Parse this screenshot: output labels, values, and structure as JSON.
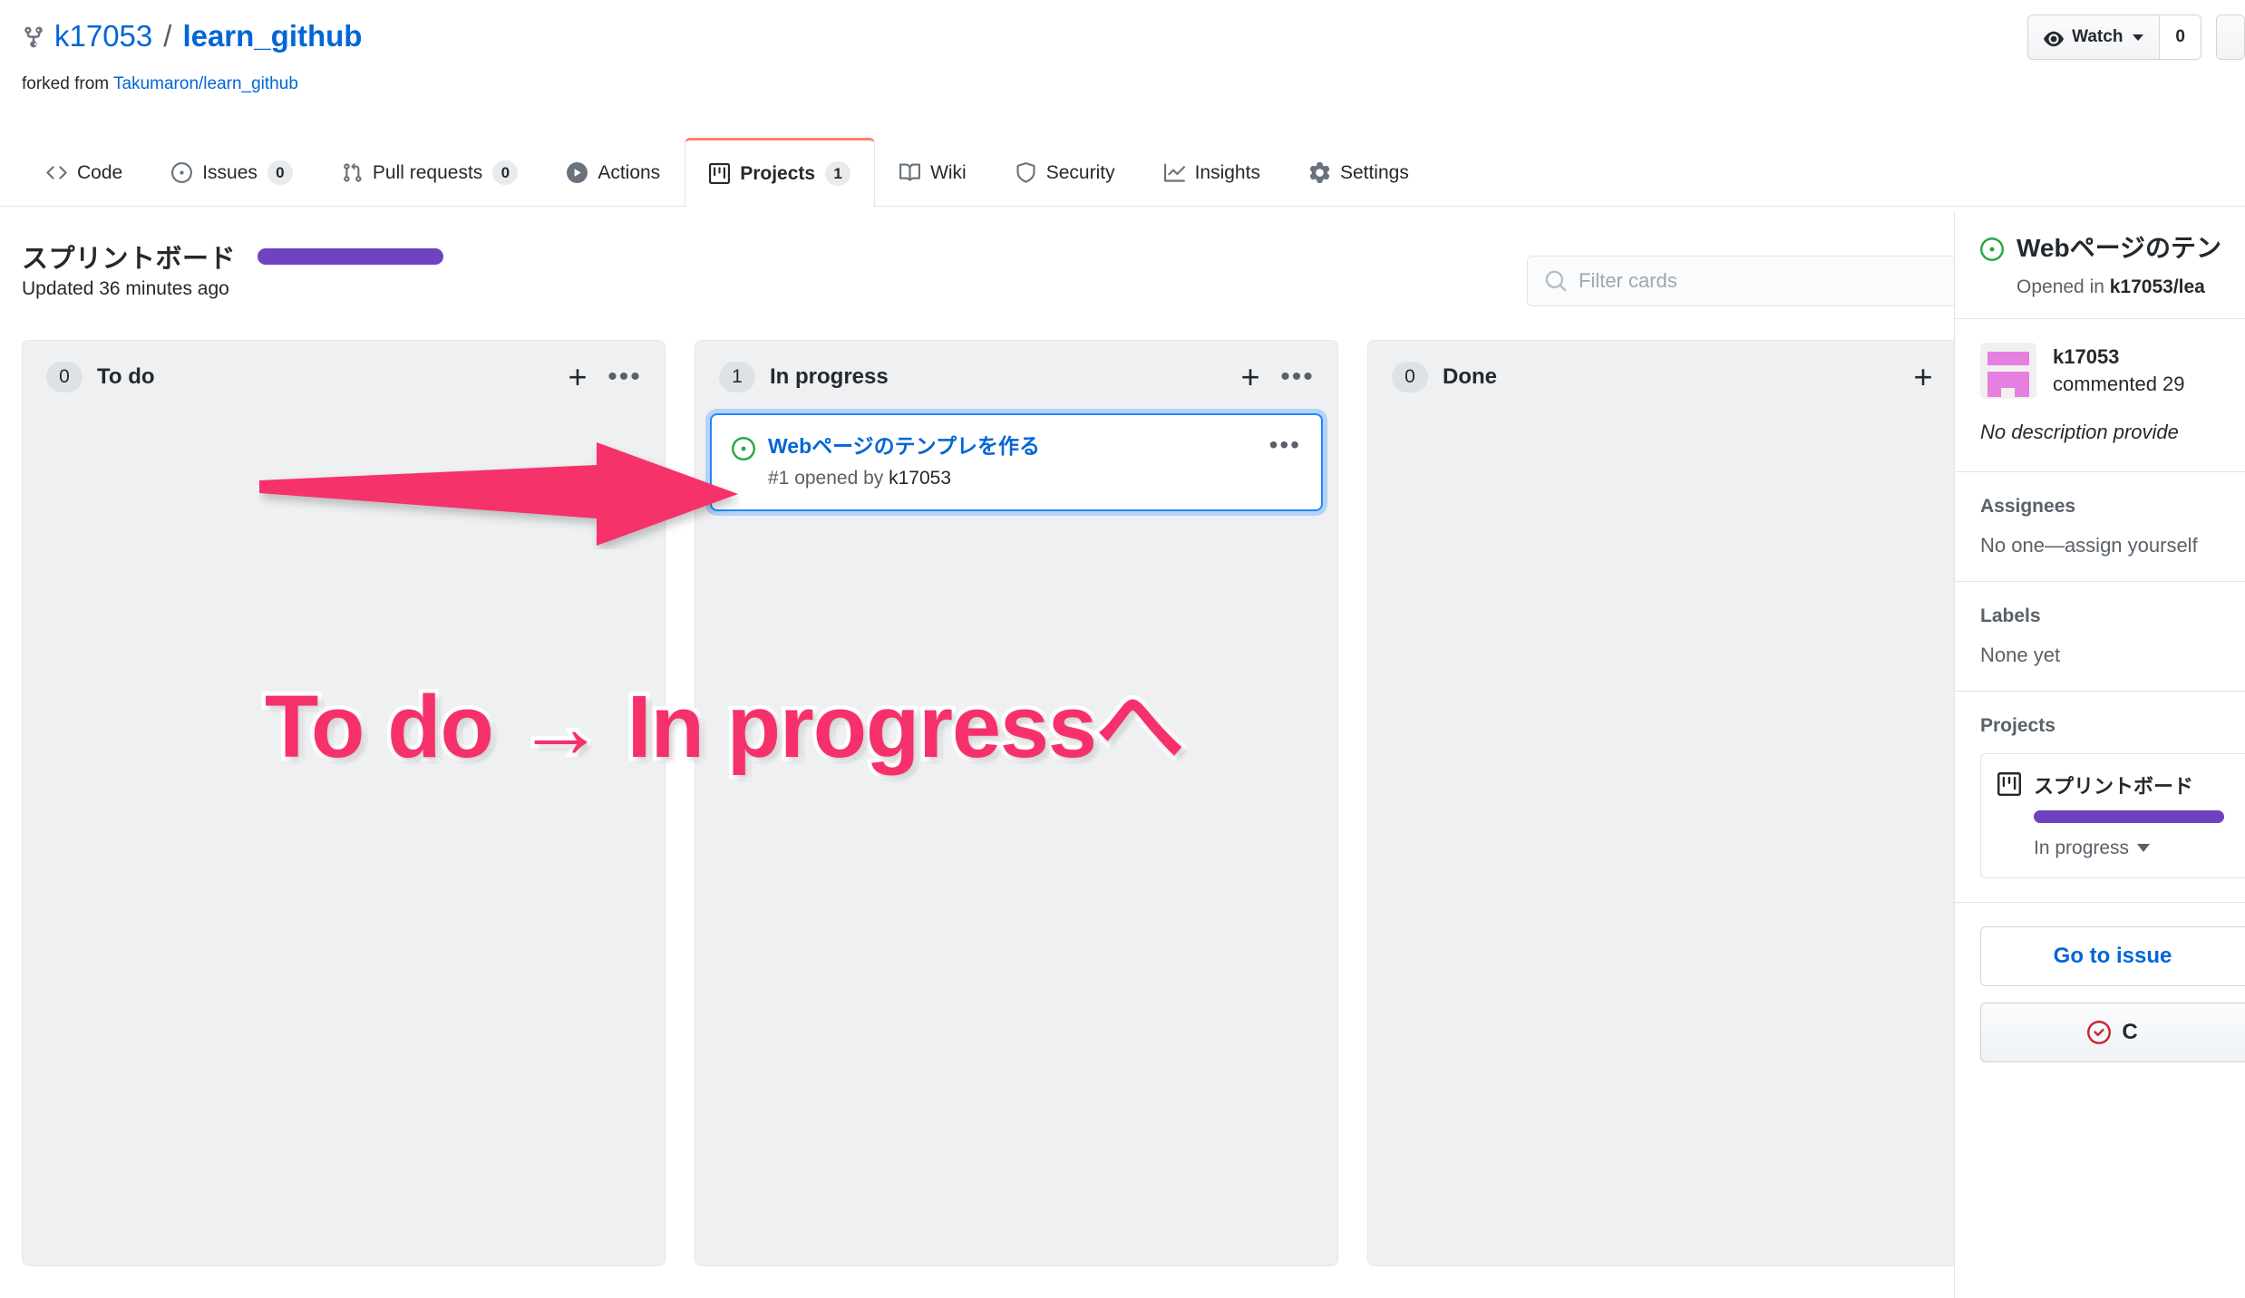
{
  "header": {
    "fork_icon": "repo-forked-icon",
    "owner": "k17053",
    "separator": "/",
    "repo": "learn_github",
    "forked_label": "forked from",
    "forked_source": "Takumaron/learn_github",
    "watch": {
      "icon": "eye-icon",
      "label": "Watch",
      "count": "0"
    }
  },
  "tabs": [
    {
      "label": "Code",
      "icon": "code-icon",
      "count": null,
      "active": false
    },
    {
      "label": "Issues",
      "icon": "issue-icon",
      "count": "0",
      "active": false
    },
    {
      "label": "Pull requests",
      "icon": "git-pull-icon",
      "count": "0",
      "active": false
    },
    {
      "label": "Actions",
      "icon": "play-icon",
      "count": null,
      "active": false
    },
    {
      "label": "Projects",
      "icon": "project-icon",
      "count": "1",
      "active": true
    },
    {
      "label": "Wiki",
      "icon": "book-icon",
      "count": null,
      "active": false
    },
    {
      "label": "Security",
      "icon": "shield-icon",
      "count": null,
      "active": false
    },
    {
      "label": "Insights",
      "icon": "graph-icon",
      "count": null,
      "active": false
    },
    {
      "label": "Settings",
      "icon": "gear-icon",
      "count": null,
      "active": false
    }
  ],
  "board": {
    "title": "スプリントボード",
    "progress_color": "#6f42c1",
    "updated": "Updated 36 minutes ago",
    "filter_placeholder": "Filter cards",
    "filter_value": "",
    "columns": [
      {
        "name": "To do",
        "count": "0",
        "cards": []
      },
      {
        "name": "In progress",
        "count": "1",
        "cards": [
          {
            "icon": "issue-opened-icon",
            "title": "Webページのテンプレを作る",
            "meta_prefix": "#1 opened by ",
            "meta_author": "k17053",
            "selected": true
          }
        ]
      },
      {
        "name": "Done",
        "count": "0",
        "cards": []
      }
    ]
  },
  "annotation": {
    "arrow": "right-arrow-annotation",
    "text": "To do → In progressへ",
    "color": "#f6306a"
  },
  "side_panel": {
    "issue_icon": "issue-opened-icon",
    "title": "Webページのテン",
    "opened_prefix": "Opened in ",
    "opened_repo": "k17053/lea",
    "comment": {
      "avatar": "user-avatar",
      "user": "k17053",
      "commented": "commented 29"
    },
    "description": "No description provide",
    "sections": [
      {
        "label": "Assignees",
        "value": "No one—assign yourself"
      },
      {
        "label": "Labels",
        "value": "None yet"
      }
    ],
    "projects_label": "Projects",
    "project": {
      "icon": "project-board-icon",
      "name": "スプリントボード",
      "progress_color": "#6f42c1",
      "status": "In progress"
    },
    "go_to_issue": "Go to issue",
    "close_issue": "C",
    "close_icon": "issue-closed-icon"
  }
}
